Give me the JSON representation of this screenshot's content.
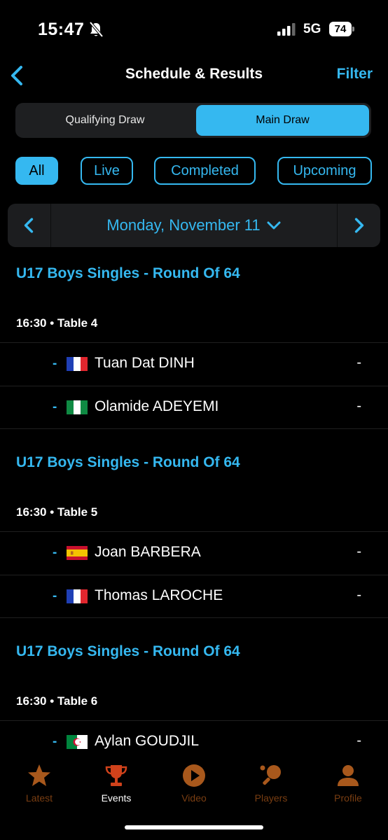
{
  "status": {
    "time": "15:47",
    "network": "5G",
    "battery": "74"
  },
  "header": {
    "title": "Schedule & Results",
    "filter_label": "Filter"
  },
  "draw_tabs": {
    "qualifying": "Qualifying Draw",
    "main": "Main Draw",
    "selected": "Main Draw"
  },
  "status_filters": {
    "all": "All",
    "live": "Live",
    "completed": "Completed",
    "upcoming": "Upcoming",
    "selected": "All"
  },
  "date_nav": {
    "label": "Monday, November 11"
  },
  "matches": [
    {
      "round": "U17 Boys Singles - Round Of 64",
      "time": "16:30",
      "table": "Table 4",
      "players": [
        {
          "seed": "-",
          "flag": "france-flag-icon",
          "name": "Tuan Dat DINH",
          "score": "-"
        },
        {
          "seed": "-",
          "flag": "nigeria-flag-icon",
          "name": "Olamide ADEYEMI",
          "score": "-"
        }
      ]
    },
    {
      "round": "U17 Boys Singles - Round Of 64",
      "time": "16:30",
      "table": "Table 5",
      "players": [
        {
          "seed": "-",
          "flag": "spain-flag-icon",
          "name": "Joan BARBERA",
          "score": "-"
        },
        {
          "seed": "-",
          "flag": "france-flag-icon",
          "name": "Thomas LAROCHE",
          "score": "-"
        }
      ]
    },
    {
      "round": "U17 Boys Singles - Round Of 64",
      "time": "16:30",
      "table": "Table 6",
      "players": [
        {
          "seed": "-",
          "flag": "algeria-flag-icon",
          "name": "Aylan GOUDJIL",
          "score": "-"
        },
        {
          "seed": "-",
          "flag": "",
          "name": "",
          "score": ""
        }
      ]
    }
  ],
  "tabbar": {
    "items": [
      {
        "label": "Latest",
        "icon": "star-icon"
      },
      {
        "label": "Events",
        "icon": "trophy-icon"
      },
      {
        "label": "Video",
        "icon": "play-icon"
      },
      {
        "label": "Players",
        "icon": "table-tennis-icon"
      },
      {
        "label": "Profile",
        "icon": "person-icon"
      }
    ],
    "selected": "Events"
  },
  "colors": {
    "accent": "#35b8f0",
    "tab_inactive": "#7a3e12",
    "tab_icon_inactive": "#a8581c",
    "tab_icon_active": "#d0421b",
    "background": "#000000"
  }
}
